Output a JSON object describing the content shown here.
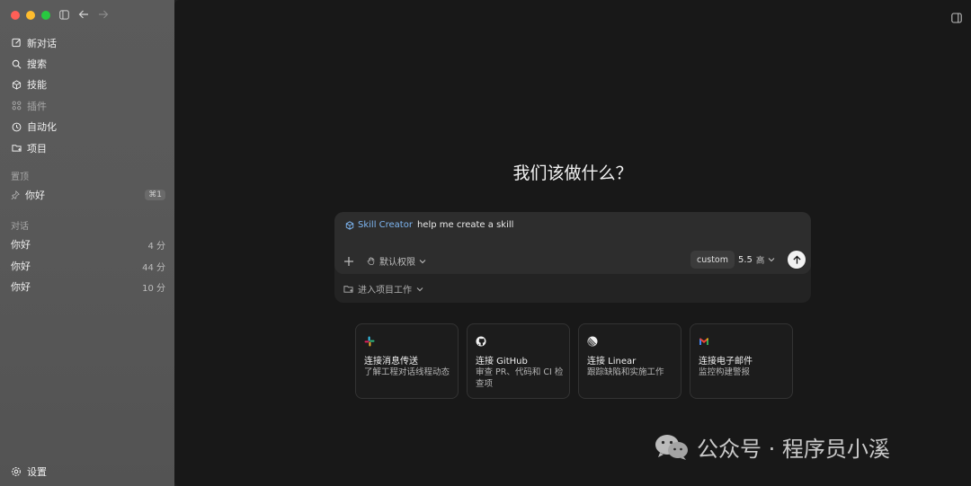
{
  "sidebar": {
    "nav": [
      {
        "label": "新对话",
        "icon": "new-chat-icon"
      },
      {
        "label": "搜索",
        "icon": "search-icon"
      },
      {
        "label": "技能",
        "icon": "skills-cube-icon"
      },
      {
        "label": "插件",
        "icon": "plugins-grid-icon"
      },
      {
        "label": "自动化",
        "icon": "clock-icon"
      },
      {
        "label": "项目",
        "icon": "folder-icon"
      }
    ],
    "pinned_label": "置顶",
    "pinned": [
      {
        "label": "你好",
        "shortcut": "⌘1"
      }
    ],
    "chats_label": "对话",
    "chats": [
      {
        "label": "你好",
        "time": "4 分"
      },
      {
        "label": "你好",
        "time": "44 分"
      },
      {
        "label": "你好",
        "time": "10 分"
      }
    ],
    "settings_label": "设置"
  },
  "main": {
    "heading": "我们该做什么？",
    "composer": {
      "skill_label": "Skill Creator",
      "prompt_text": "help me create a skill",
      "permission_label": "默认权限",
      "mode_label": "custom",
      "model_label": "5.5",
      "effort_label": "高",
      "project_label": "进入项目工作"
    },
    "cards": [
      {
        "title": "连接消息传送",
        "desc": "了解工程对话线程动态",
        "icon": "slack-icon"
      },
      {
        "title": "连接 GitHub",
        "desc": "审查 PR、代码和 CI 检查项",
        "icon": "github-icon"
      },
      {
        "title": "连接 Linear",
        "desc": "跟踪缺陷和实施工作",
        "icon": "linear-icon"
      },
      {
        "title": "连接电子邮件",
        "desc": "监控构建警报",
        "icon": "gmail-icon"
      }
    ]
  },
  "watermark": "公众号 · 程序员小溪",
  "colors": {
    "accent": "#7eb6f2",
    "sidebar_bg": "#595959",
    "main_bg": "#181818"
  }
}
